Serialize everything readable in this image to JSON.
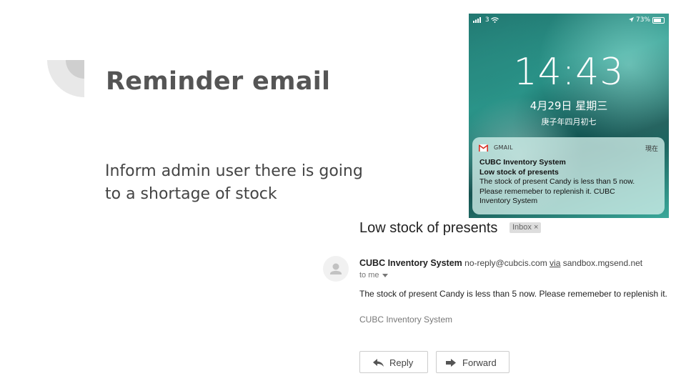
{
  "slide": {
    "title": "Reminder email",
    "subtitle_lines": [
      "Inform admin user there is going",
      "to a shortage of stock"
    ]
  },
  "phone": {
    "carrier": "3",
    "battery": "73%",
    "time": "14:43",
    "date": "4月29日 星期三",
    "lunar_date": "庚子年四月初七",
    "notification": {
      "app": "GMAIL",
      "time": "現在",
      "sender": "CUBC Inventory System",
      "subject": "Low stock of presents",
      "body_lines": [
        "The stock of present Candy is less than 5 now.",
        "Please rememeber to replenish it. CUBC",
        "Inventory System"
      ]
    }
  },
  "email": {
    "subject": "Low stock of presents",
    "label": "Inbox",
    "label_close": "×",
    "sender_name": "CUBC Inventory System",
    "sender_email": "no-reply@cubcis.com",
    "via_label": "via",
    "via_domain": "sandbox.mgsend.net",
    "recipient": "to me",
    "body": "The stock of present Candy is less than 5 now. Please rememeber to replenish it.",
    "signature": "CUBC Inventory System",
    "reply_label": "Reply",
    "forward_label": "Forward"
  },
  "icons": {
    "decoration": "quarter-circle-decoration",
    "avatar": "person-avatar-icon",
    "reply": "reply-arrow-icon",
    "forward": "forward-arrow-icon",
    "gmail": "gmail-icon",
    "wifi": "wifi-icon",
    "battery": "battery-icon"
  },
  "colors": {
    "title": "#555555",
    "gmail_red": "#d93025"
  }
}
